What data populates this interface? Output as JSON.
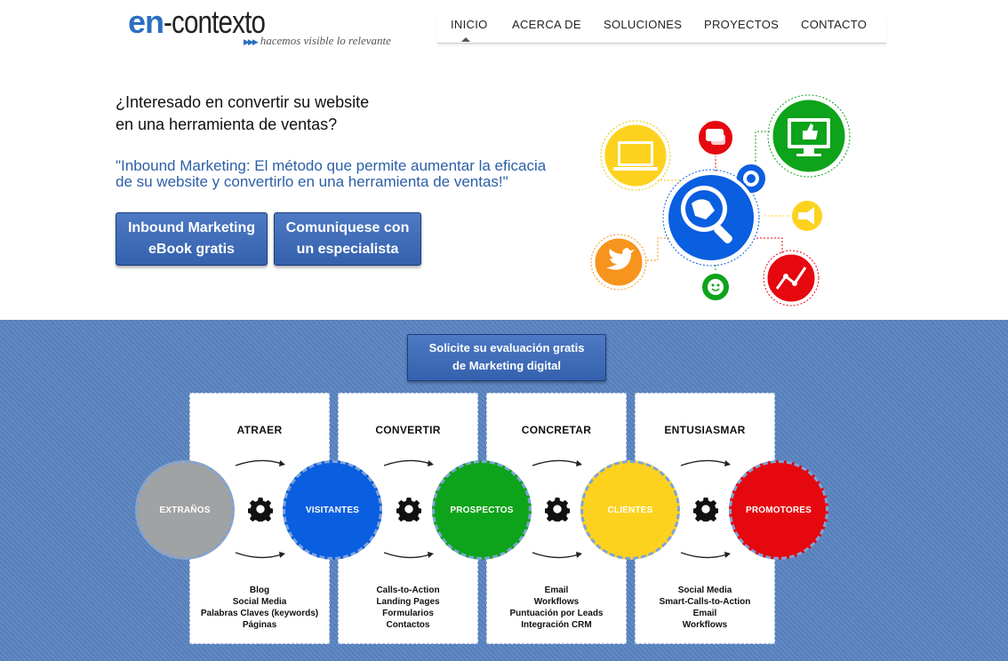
{
  "logo": {
    "prefix": "en",
    "suffix": "-contexto",
    "tagline": "hacemos visible lo relevante"
  },
  "nav": {
    "items": [
      "INICIO",
      "ACERCA DE",
      "SOLUCIONES",
      "PROYECTOS",
      "CONTACTO"
    ],
    "active": "INICIO"
  },
  "hero": {
    "title_line1": "¿Interesado en convertir su website",
    "title_line2": "en una herramienta de ventas?",
    "quote_line1": "\"Inbound Marketing: El método que permite aumentar la eficacia",
    "quote_line2": "de su website y convertirlo en una herramienta de ventas!\""
  },
  "buttons": {
    "ebook_line1": "Inbound Marketing",
    "ebook_line2": "eBook gratis",
    "contact_line1": "Comuniquese con",
    "contact_line2": "un especialista",
    "evaluation_line1": "Solicite su evaluación gratis",
    "evaluation_line2": "de Marketing digital"
  },
  "stages": [
    {
      "title": "ATRAER",
      "items": [
        "Blog",
        "Social Media",
        "Palabras Claves (keywords)",
        "Páginas"
      ]
    },
    {
      "title": "CONVERTIR",
      "items": [
        "Calls-to-Action",
        "Landing Pages",
        "Formularios",
        "Contactos"
      ]
    },
    {
      "title": "CONCRETAR",
      "items": [
        "Email",
        "Workflows",
        "Puntuación por Leads",
        "Integración CRM"
      ]
    },
    {
      "title": "ENTUSIASMAR",
      "items": [
        "Social Media",
        "Smart-Calls-to-Action",
        "Email",
        "Workflows"
      ]
    }
  ],
  "circles": [
    {
      "label": "EXTRAÑOS",
      "color": "#a0a2a4"
    },
    {
      "label": "VISITANTES",
      "color": "#0a5ee0"
    },
    {
      "label": "PROSPECTOS",
      "color": "#0da31a"
    },
    {
      "label": "CLIENTES",
      "color": "#fdd21f"
    },
    {
      "label": "PROMOTORES",
      "color": "#e5080f"
    }
  ],
  "icons": [
    "laptop-icon",
    "chat-icon",
    "network-icon",
    "thumbs-up-monitor-icon",
    "megaphone-icon",
    "twitter-bird-icon",
    "smiley-icon",
    "chart-line-icon",
    "globe-search-icon",
    "gear-icon"
  ],
  "colors": {
    "brand_blue": "#2b6fc2",
    "section_blue": "#5a84c2",
    "button_blue": "#3d6ab8"
  }
}
